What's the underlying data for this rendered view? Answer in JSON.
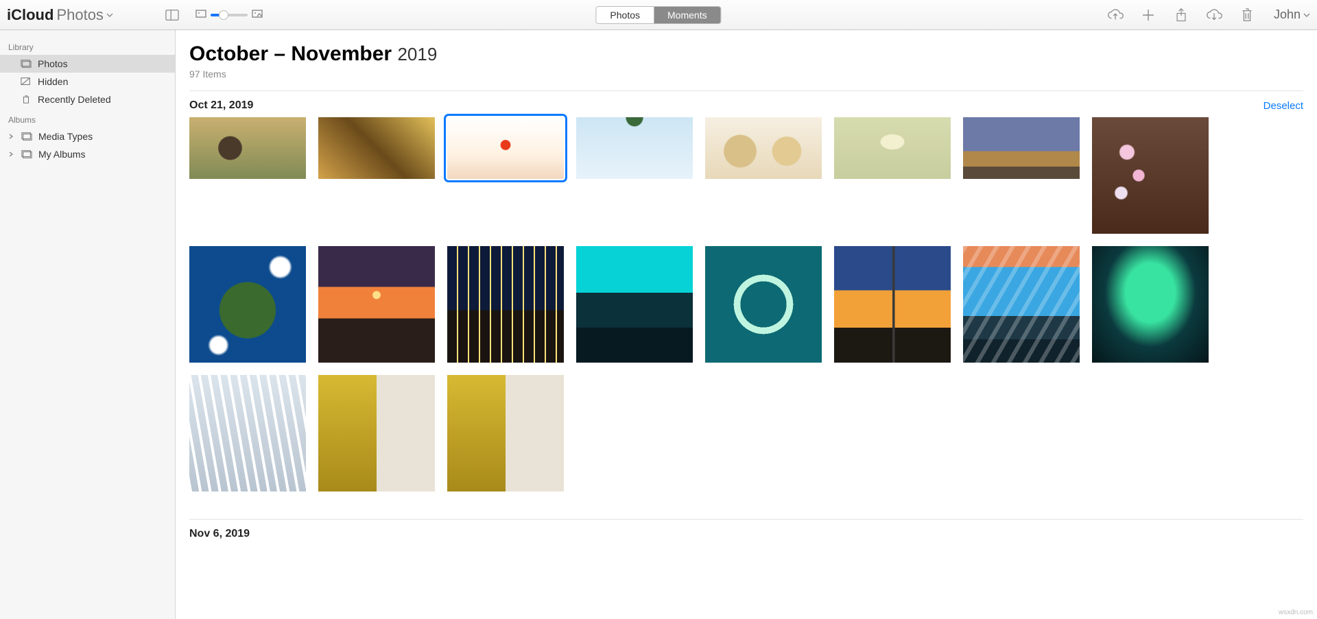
{
  "brand": {
    "name1": "iCloud",
    "name2": "Photos"
  },
  "segments": {
    "photos": "Photos",
    "moments": "Moments",
    "active": "moments"
  },
  "user": {
    "name": "John"
  },
  "sidebar": {
    "headings": {
      "library": "Library",
      "albums": "Albums"
    },
    "library": [
      {
        "label": "Photos",
        "active": true
      },
      {
        "label": "Hidden"
      },
      {
        "label": "Recently Deleted"
      }
    ],
    "albums": [
      {
        "label": "Media Types"
      },
      {
        "label": "My Albums"
      }
    ]
  },
  "title": {
    "range": "October – November",
    "year": "2019"
  },
  "subtitle": "97 Items",
  "sections": [
    {
      "date": "Oct 21, 2019",
      "action": "Deselect"
    },
    {
      "date": "Nov 6, 2019"
    }
  ],
  "attribution": "wsxdn.com"
}
